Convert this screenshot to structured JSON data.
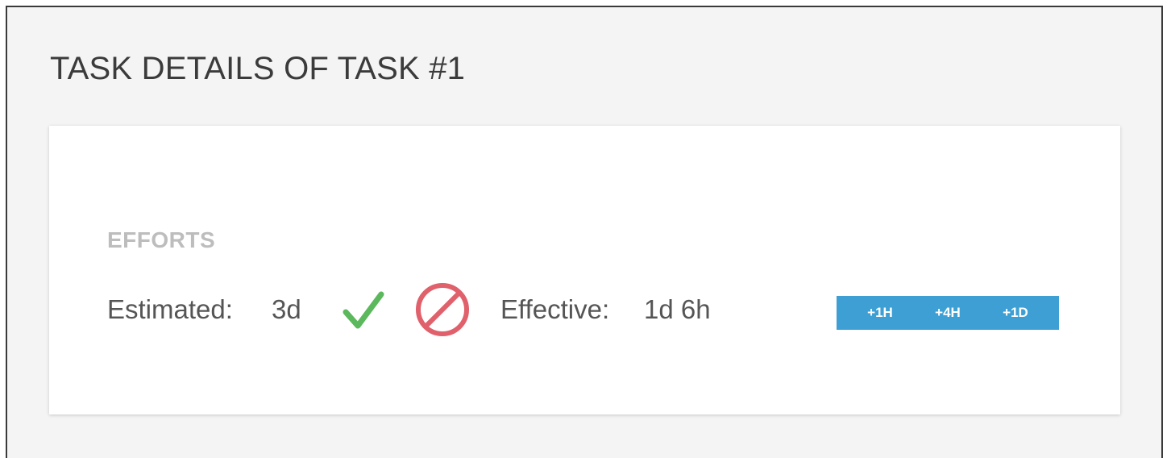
{
  "page": {
    "title": "TASK DETAILS OF TASK #1"
  },
  "efforts": {
    "section_label": "EFFORTS",
    "estimated_label": "Estimated:",
    "estimated_value": "3d",
    "effective_label": "Effective:",
    "effective_value": "1d 6h",
    "confirm_icon": "check-icon",
    "cancel_icon": "cancel-icon",
    "buttons": [
      {
        "label": "+1H"
      },
      {
        "label": "+4H"
      },
      {
        "label": "+1D"
      }
    ]
  },
  "colors": {
    "confirm": "#5cb85c",
    "cancel": "#e0606b",
    "effort_buttons": "#3d9fd3",
    "section_label": "#bdbdbd"
  }
}
